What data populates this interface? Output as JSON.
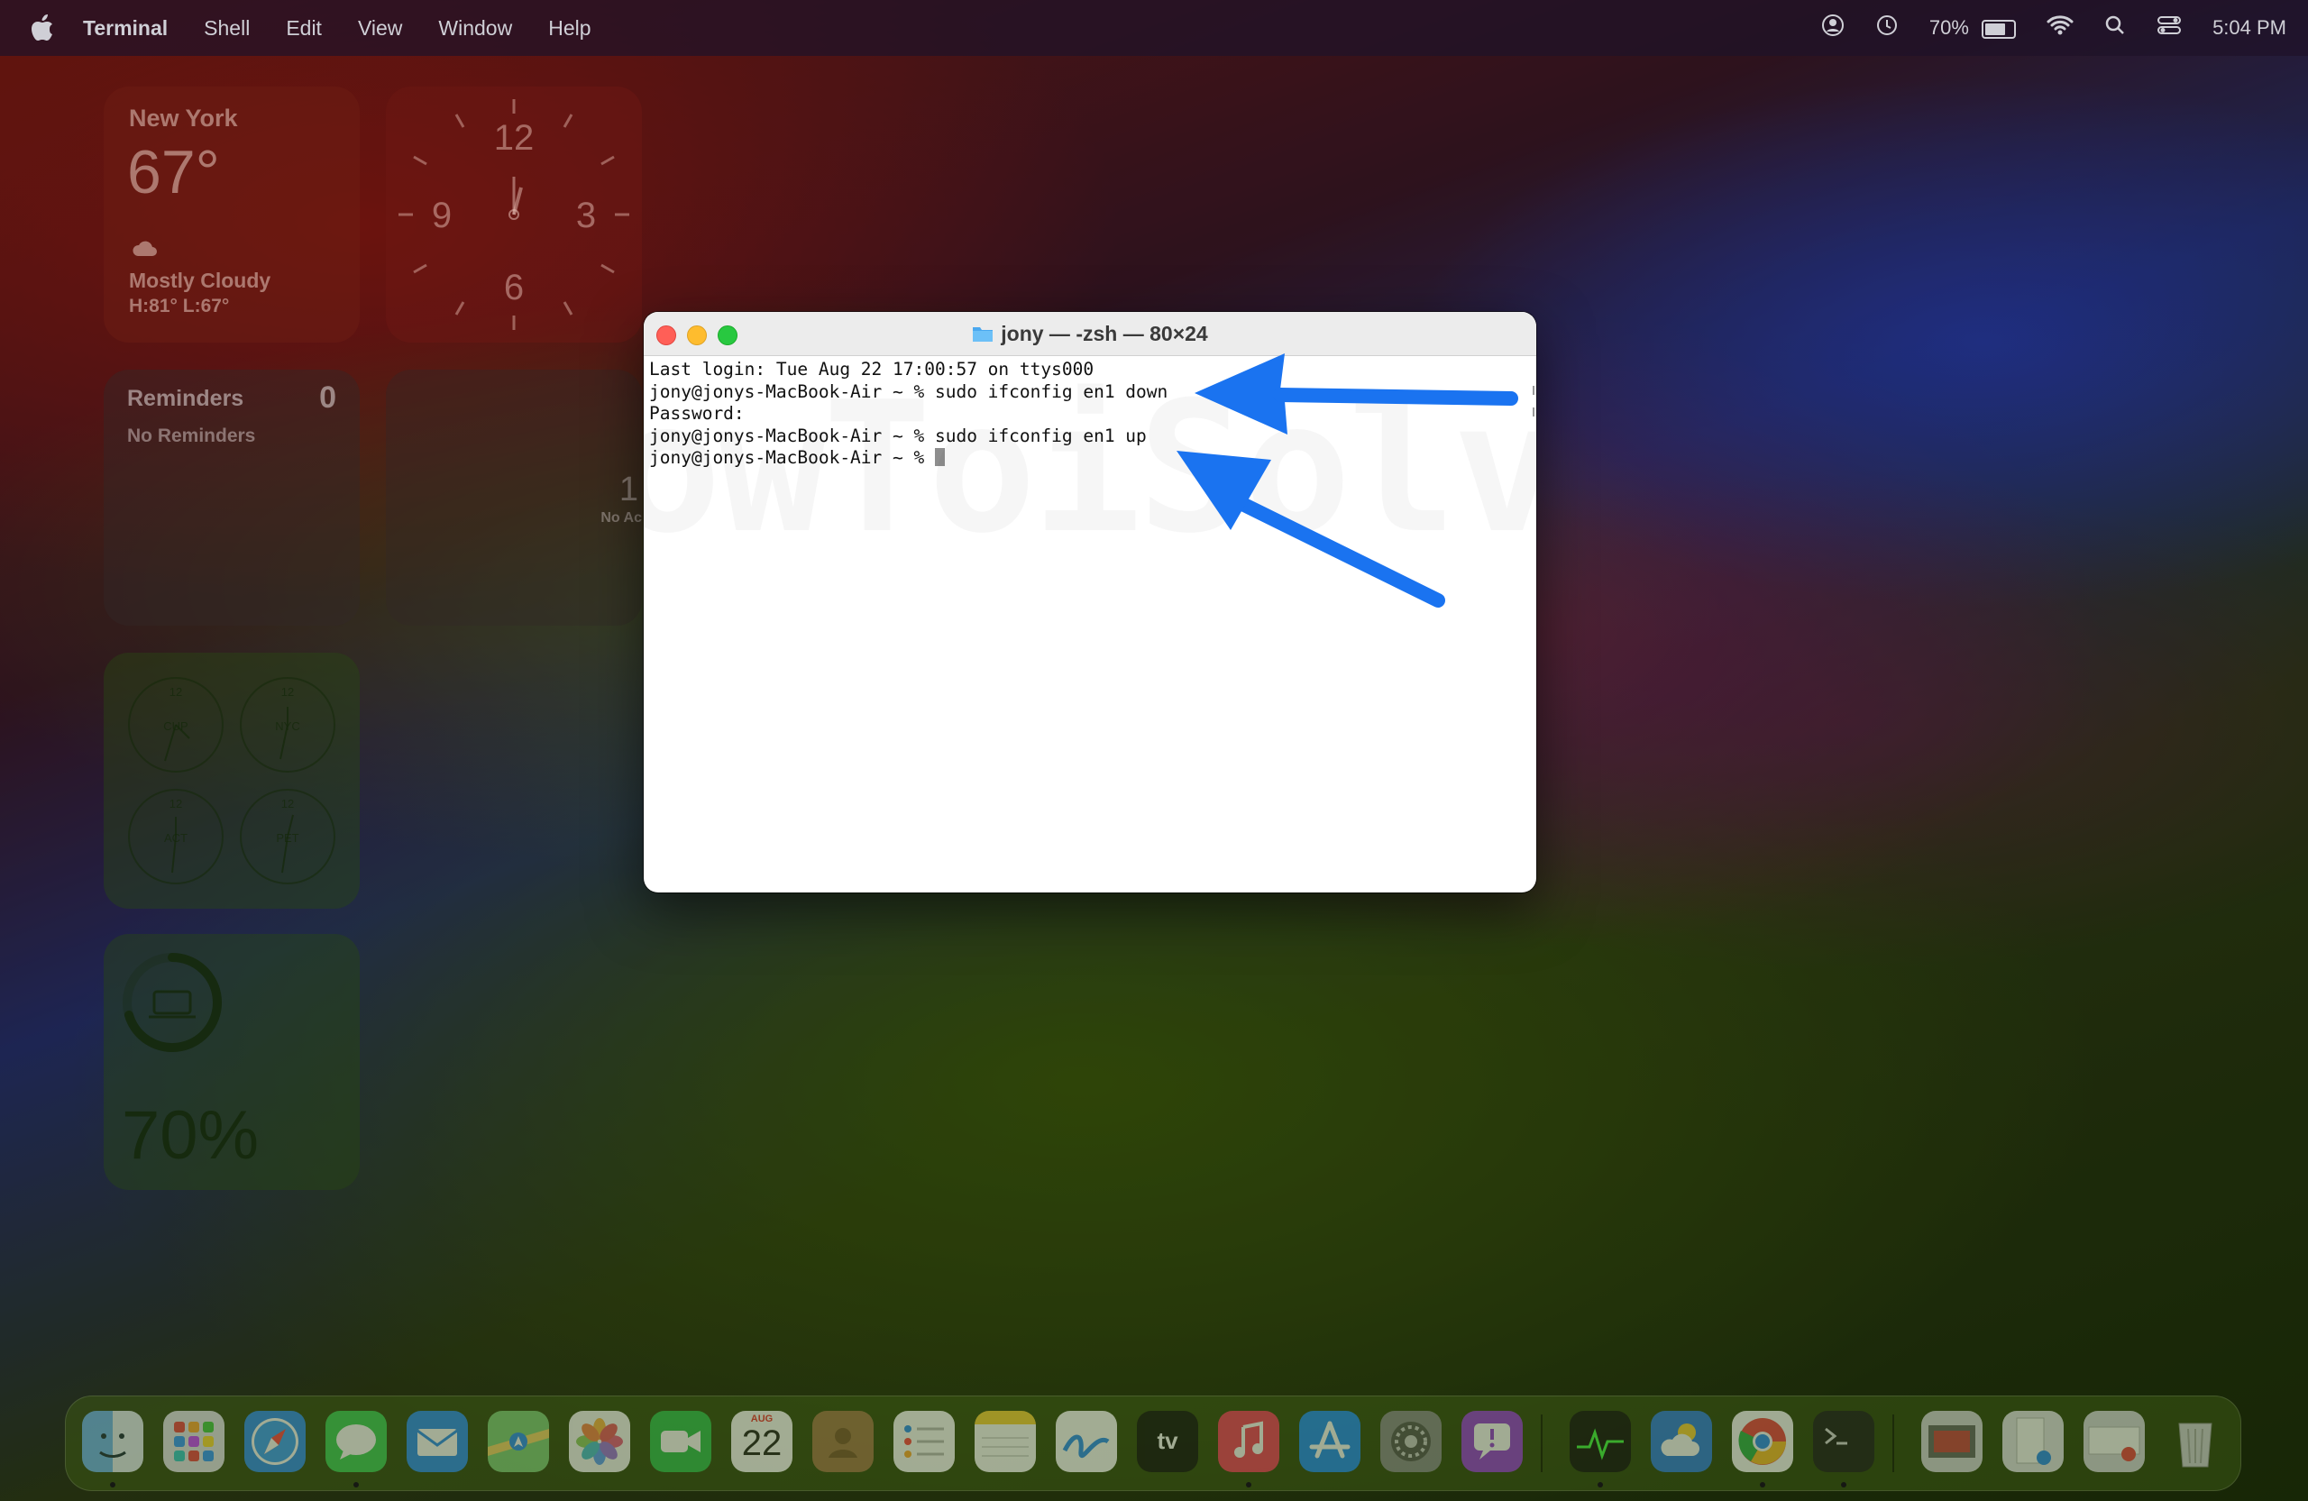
{
  "menubar": {
    "apple": "apple-icon",
    "app_name": "Terminal",
    "items": [
      "Shell",
      "Edit",
      "View",
      "Window",
      "Help"
    ],
    "battery_percent": "70%",
    "time": "5:04 PM"
  },
  "widgets": {
    "weather": {
      "city": "New York",
      "temp": "67°",
      "condition": "Mostly Cloudy",
      "high_low": "H:81° L:67°"
    },
    "clock": {
      "numbers": [
        "12",
        "3",
        "6",
        "9"
      ]
    },
    "reminders": {
      "title": "Reminders",
      "count": "0",
      "empty": "No Reminders"
    },
    "activity": {
      "value": "1",
      "label": "No Ac"
    },
    "world_clock": {
      "cities": [
        "CUP",
        "NYC",
        "ACT",
        "PET"
      ]
    },
    "battery": {
      "percent": "70%",
      "level": 0.7
    }
  },
  "terminal": {
    "title": "jony — -zsh — 80×24",
    "lines": [
      "Last login: Tue Aug 22 17:00:57 on ttys000",
      "jony@jonys-MacBook-Air ~ % sudo ifconfig en1 down",
      "Password:",
      "jony@jonys-MacBook-Air ~ % sudo ifconfig en1 up",
      "jony@jonys-MacBook-Air ~ % "
    ],
    "watermark": "owToiSolve.c"
  },
  "annotations": {
    "arrow_color": "#1a73f0"
  },
  "dock": {
    "calendar_month": "AUG",
    "calendar_day": "22",
    "tv_label": "tv",
    "apps": [
      "finder-icon",
      "launchpad-icon",
      "safari-icon",
      "messages-icon",
      "mail-icon",
      "maps-icon",
      "photos-icon",
      "facetime-icon",
      "calendar-icon",
      "contacts-icon",
      "reminders-icon",
      "notes-icon",
      "freeform-icon",
      "apple-tv-icon",
      "music-icon",
      "app-store-icon",
      "system-settings-icon",
      "feedback-assistant-icon",
      "activity-monitor-icon",
      "weather-icon",
      "chrome-icon",
      "terminal-icon",
      "downloads-icon",
      "documents-icon",
      "recent-window-icon",
      "trash-icon"
    ]
  }
}
